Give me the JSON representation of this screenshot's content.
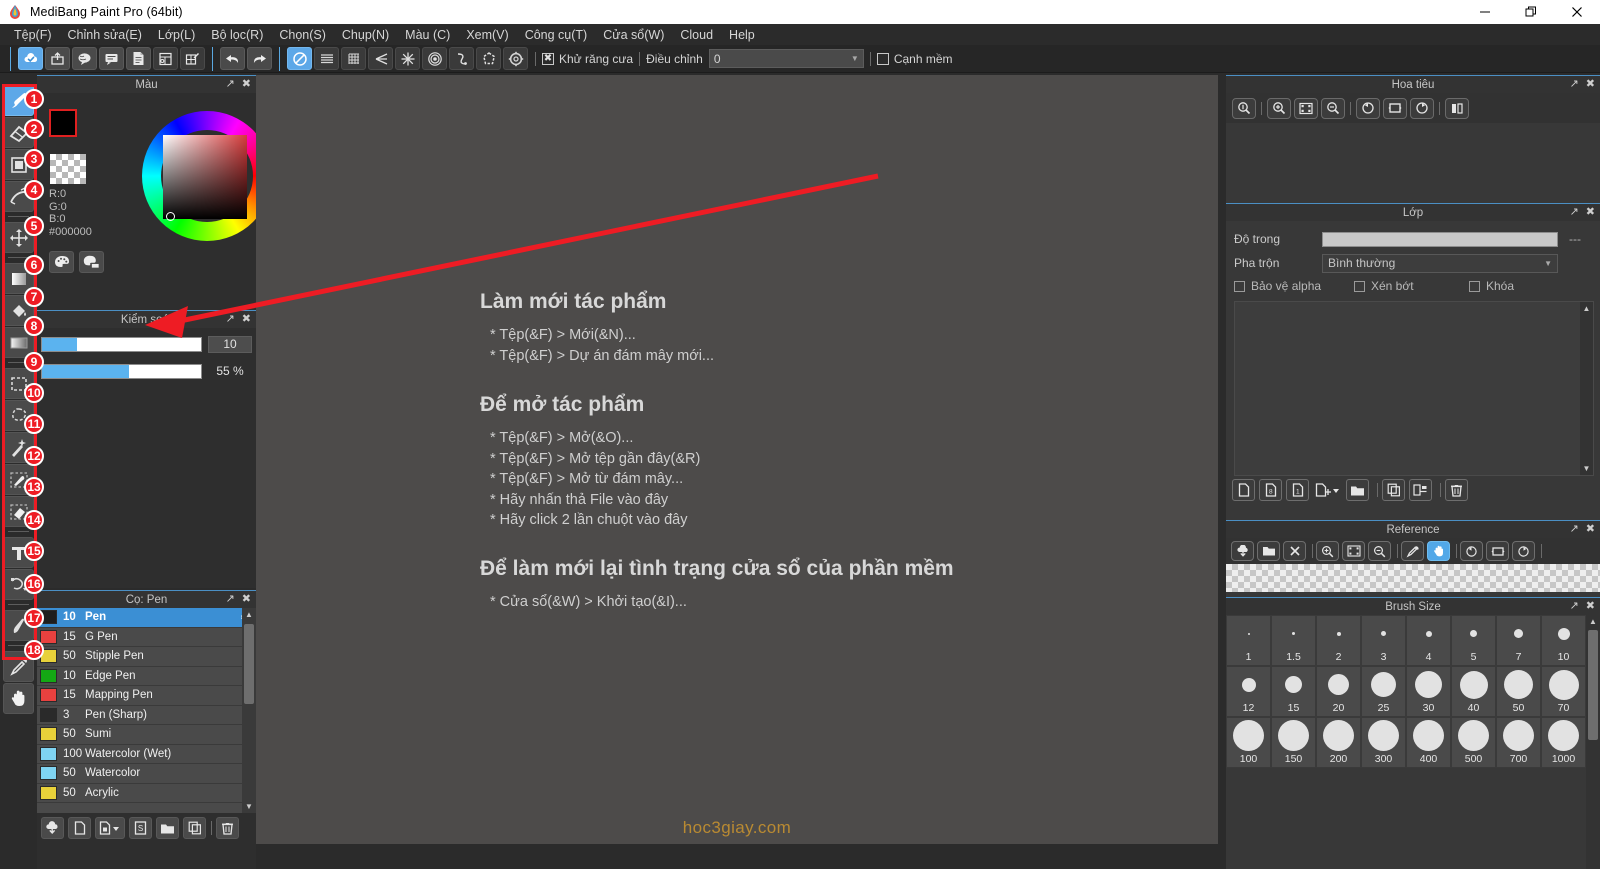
{
  "window": {
    "title": "MediBang Paint Pro (64bit)",
    "minimize": "minimize-button",
    "maximize": "restore-button",
    "close": "close-button"
  },
  "menubar": {
    "items": [
      {
        "label": "Tệp(F)"
      },
      {
        "label": "Chỉnh sửa(E)"
      },
      {
        "label": "Lớp(L)"
      },
      {
        "label": "Bộ lọc(R)"
      },
      {
        "label": "Chọn(S)"
      },
      {
        "label": "Chụp(N)"
      },
      {
        "label": "Màu (C)"
      },
      {
        "label": "Xem(V)"
      },
      {
        "label": "Công cụ(T)"
      },
      {
        "label": "Cửa sổ(W)"
      },
      {
        "label": "Cloud"
      },
      {
        "label": "Help"
      }
    ]
  },
  "toolbar": {
    "left_buttons": [
      {
        "name": "cloud-save-icon",
        "active": true
      },
      {
        "name": "cloud-upload-icon",
        "active": false
      },
      {
        "name": "comment-icon",
        "active": false
      },
      {
        "name": "speech-bubble-icon",
        "active": false
      },
      {
        "name": "page-icon",
        "active": false
      },
      {
        "name": "panel-layout-icon",
        "active": false
      },
      {
        "name": "grid-edit-icon",
        "active": false
      }
    ],
    "history_buttons": [
      {
        "name": "undo-icon"
      },
      {
        "name": "redo-icon"
      }
    ],
    "ruler_buttons": [
      {
        "name": "no-ruler-icon",
        "active": true
      },
      {
        "name": "parallel-ruler-icon",
        "active": false
      },
      {
        "name": "grid-ruler-icon",
        "active": false
      },
      {
        "name": "perspective-ruler-icon",
        "active": false
      },
      {
        "name": "radial-ruler-icon",
        "active": false
      },
      {
        "name": "concentric-ruler-icon",
        "active": false
      },
      {
        "name": "curve-ruler-icon",
        "active": false
      },
      {
        "name": "polygon-ruler-icon",
        "active": false
      },
      {
        "name": "ruler-settings-gear-icon",
        "active": false
      }
    ],
    "antialias_label": "Khử răng cưa",
    "antialias_checked": true,
    "adjust_label": "Điều chỉnh",
    "adjust_value": "0",
    "soft_edge_label": "Cạnh mềm",
    "soft_edge_checked": false
  },
  "tools": {
    "items": [
      {
        "n": "1",
        "name": "brush-tool",
        "selected": true
      },
      {
        "n": "2",
        "name": "eraser-tool",
        "selected": false
      },
      {
        "n": "3",
        "name": "fill-rect-tool",
        "selected": false
      },
      {
        "n": "4",
        "name": "curve-tool",
        "selected": false
      },
      {
        "n": "5",
        "name": "move-tool",
        "selected": false
      },
      {
        "n": "6",
        "name": "gradient-tool",
        "selected": false
      },
      {
        "n": "7",
        "name": "bucket-fill-tool",
        "selected": false
      },
      {
        "n": "8",
        "name": "gradient-fill-tool",
        "selected": false
      },
      {
        "n": "9",
        "name": "rect-select-tool",
        "selected": false
      },
      {
        "n": "10",
        "name": "lasso-select-tool",
        "selected": false
      },
      {
        "n": "11",
        "name": "magic-wand-tool",
        "selected": false
      },
      {
        "n": "12",
        "name": "select-brush-tool",
        "selected": false
      },
      {
        "n": "13",
        "name": "select-eraser-tool",
        "selected": false
      },
      {
        "n": "14",
        "name": "text-tool",
        "selected": false
      },
      {
        "n": "15",
        "name": "transform-tool",
        "selected": false
      },
      {
        "n": "16",
        "name": "blur-tool",
        "selected": false
      },
      {
        "n": "17",
        "name": "eyedropper-tool",
        "selected": false
      },
      {
        "n": "18",
        "name": "hand-tool",
        "selected": false
      }
    ]
  },
  "color_panel": {
    "title": "Màu",
    "r_label": "R:0",
    "g_label": "G:0",
    "b_label": "B:0",
    "hex": "#000000",
    "foreground": "#000000",
    "background": "#000000",
    "palette_button": "palette-icon",
    "palette_add_button": "palette-add-icon"
  },
  "control_panel": {
    "title": "Kiểm soát",
    "size_value": "10",
    "size_percent": 22,
    "opacity_value": "55 %",
    "opacity_percent": 55
  },
  "brush_panel": {
    "title": "Cọ: Pen",
    "rows": [
      {
        "color": "#1e1e1e",
        "size": "10",
        "name": "Pen",
        "selected": true
      },
      {
        "color": "#e8413f",
        "size": "15",
        "name": "G Pen",
        "selected": false
      },
      {
        "color": "#e8d13a",
        "size": "50",
        "name": "Stipple Pen",
        "selected": false
      },
      {
        "color": "#14a814",
        "size": "10",
        "name": "Edge Pen",
        "selected": false
      },
      {
        "color": "#e8413f",
        "size": "15",
        "name": "Mapping Pen",
        "selected": false
      },
      {
        "color": "#2a2a2a",
        "size": "3",
        "name": "Pen (Sharp)",
        "selected": false
      },
      {
        "color": "#e8d13a",
        "size": "50",
        "name": "Sumi",
        "selected": false
      },
      {
        "color": "#7fd4f2",
        "size": "100",
        "name": "Watercolor (Wet)",
        "selected": false
      },
      {
        "color": "#7fd4f2",
        "size": "50",
        "name": "Watercolor",
        "selected": false
      },
      {
        "color": "#e8d13a",
        "size": "50",
        "name": "Acrylic",
        "selected": false
      }
    ],
    "footer_buttons": [
      {
        "name": "brush-download-icon"
      },
      {
        "name": "brush-new-icon"
      },
      {
        "name": "brush-new-from-icon"
      },
      {
        "name": "brush-script-icon"
      },
      {
        "name": "brush-folder-icon"
      },
      {
        "name": "brush-duplicate-icon"
      },
      {
        "name": "brush-delete-icon"
      }
    ]
  },
  "canvas": {
    "sections": [
      {
        "heading": "Làm mới tác phẩm",
        "items": [
          "* Tệp(&F) > Mới(&N)...",
          "* Tệp(&F) > Dự án đám mây mới..."
        ]
      },
      {
        "heading": "Để mở tác phẩm",
        "items": [
          "* Tệp(&F) > Mở(&O)...",
          "* Tệp(&F) > Mở tệp gần đây(&R)",
          "* Tệp(&F) > Mở từ đám mây...",
          "* Hãy nhấn thả File vào đây",
          "* Hãy click 2 lần chuột vào đây"
        ]
      },
      {
        "heading": "Để làm mới lại tình trạng cửa sổ của phần mềm",
        "items": [
          "* Cửa sổ(&W) > Khởi tạo(&I)..."
        ]
      }
    ],
    "watermark": "hoc3giay.com"
  },
  "navigator_panel": {
    "title": "Hoa tiêu",
    "buttons": [
      {
        "name": "zoom-actual-icon"
      },
      {
        "name": "zoom-in-icon"
      },
      {
        "name": "fit-screen-icon"
      },
      {
        "name": "zoom-out-icon"
      },
      {
        "name": "rotate-left-icon"
      },
      {
        "name": "reset-rotation-icon"
      },
      {
        "name": "rotate-right-icon"
      },
      {
        "name": "flip-horizontal-icon"
      }
    ]
  },
  "layer_panel": {
    "title": "Lớp",
    "opacity_label": "Độ trong",
    "opacity_value": "---",
    "blend_label": "Pha trộn",
    "blend_value": "Bình thường",
    "checkboxes": [
      {
        "label": "Bảo vệ alpha",
        "checked": false
      },
      {
        "label": "Xén bớt",
        "checked": false
      },
      {
        "label": "Khóa",
        "checked": false
      }
    ],
    "footer_buttons": [
      {
        "name": "add-layer-icon"
      },
      {
        "name": "add-8bit-layer-icon"
      },
      {
        "name": "add-1bit-layer-icon"
      },
      {
        "name": "add-layer-from-icon"
      },
      {
        "name": "layer-folder-icon"
      },
      {
        "name": "duplicate-layer-icon"
      },
      {
        "name": "merge-layer-icon"
      },
      {
        "name": "delete-layer-icon"
      }
    ]
  },
  "reference_panel": {
    "title": "Reference",
    "buttons": [
      {
        "name": "reference-load-icon",
        "active": false
      },
      {
        "name": "reference-open-folder-icon",
        "active": false
      },
      {
        "name": "reference-clear-icon",
        "active": false
      },
      {
        "name": "reference-zoom-in-icon",
        "active": false
      },
      {
        "name": "reference-fit-icon",
        "active": false
      },
      {
        "name": "reference-zoom-out-icon",
        "active": false
      },
      {
        "name": "reference-eyedropper-icon",
        "active": false
      },
      {
        "name": "reference-hand-icon",
        "active": true
      },
      {
        "name": "reference-rotate-left-icon",
        "active": false
      },
      {
        "name": "reference-reset-rotation-icon",
        "active": false
      },
      {
        "name": "reference-rotate-right-icon",
        "active": false
      }
    ]
  },
  "brush_size_panel": {
    "title": "Brush Size",
    "sizes": [
      {
        "label": "1",
        "dot": 2
      },
      {
        "label": "1.5",
        "dot": 3
      },
      {
        "label": "2",
        "dot": 4
      },
      {
        "label": "3",
        "dot": 5
      },
      {
        "label": "4",
        "dot": 6
      },
      {
        "label": "5",
        "dot": 7
      },
      {
        "label": "7",
        "dot": 9
      },
      {
        "label": "10",
        "dot": 12
      },
      {
        "label": "12",
        "dot": 14
      },
      {
        "label": "15",
        "dot": 17
      },
      {
        "label": "20",
        "dot": 21
      },
      {
        "label": "25",
        "dot": 25
      },
      {
        "label": "30",
        "dot": 27
      },
      {
        "label": "40",
        "dot": 28
      },
      {
        "label": "50",
        "dot": 29
      },
      {
        "label": "70",
        "dot": 30
      },
      {
        "label": "100",
        "dot": 31
      },
      {
        "label": "150",
        "dot": 31
      },
      {
        "label": "200",
        "dot": 31
      },
      {
        "label": "300",
        "dot": 31
      },
      {
        "label": "400",
        "dot": 31
      },
      {
        "label": "500",
        "dot": 31
      },
      {
        "label": "700",
        "dot": 31
      },
      {
        "label": "1000",
        "dot": 31
      }
    ]
  },
  "annotations": {
    "accent_color": "#ee1c24",
    "arrow": "red-arrow-pointing-to-control-panel",
    "highlight_box": "red-outline-around-tool-column"
  }
}
